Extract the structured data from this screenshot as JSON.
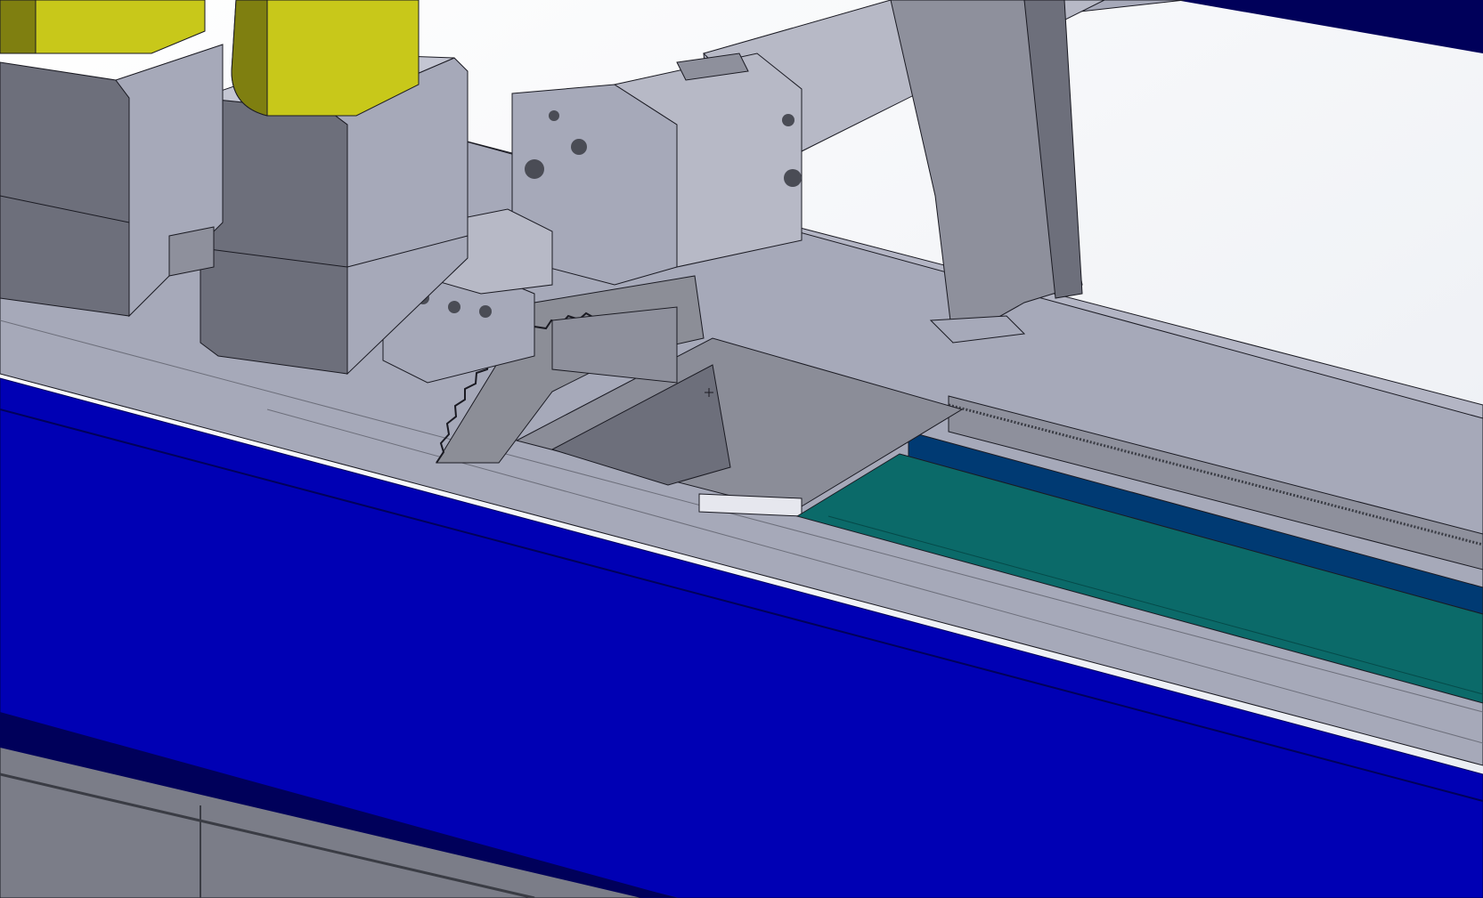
{
  "viewport": {
    "type": "cad-3d-model-view",
    "colors": {
      "background": "#ffffff",
      "background_gradient": "#e9ecf2",
      "machine_gray": "#a6a9b9",
      "machine_gray_light": "#c4c6d3",
      "machine_gray_dark": "#6d6f7b",
      "guard_blue": "#0000b4",
      "guard_blue_dark": "#00005a",
      "conveyor_teal": "#0b6a69",
      "panel_navy": "#003a73",
      "motor_yellow": "#c8c81a",
      "motor_yellow_dark": "#7f7f10",
      "saw_blade": "#8c8e97",
      "edge_line": "#1a1a22"
    },
    "parts": [
      "yellow-motor-left",
      "yellow-motor-right",
      "motor-housing-left",
      "motor-housing-right",
      "saw-head-block",
      "pneumatic-cylinder",
      "support-arm",
      "circular-saw-blade",
      "machine-bed",
      "blue-guard-panel",
      "teal-conveyor",
      "navy-side-panel",
      "lower-rail"
    ]
  }
}
